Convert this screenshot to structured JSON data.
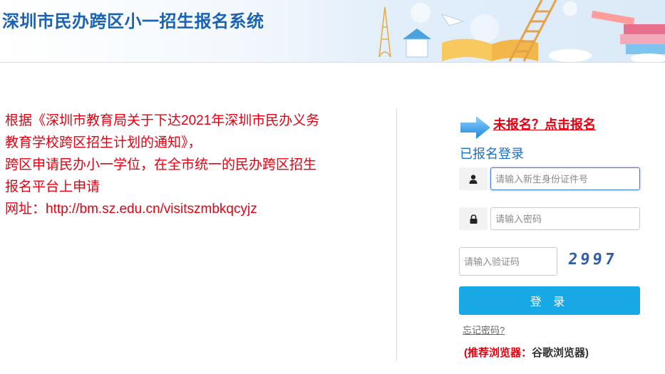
{
  "header": {
    "title": "深圳市民办跨区小一招生报名系统"
  },
  "notice": {
    "lines": [
      "根据《深圳市教育局关于下达2021年深圳市民办义务",
      "教育学校跨区招生计划的通知》，",
      "跨区申请民办小一学位，在全市统一的民办跨区招生",
      "报名平台上申请",
      "网址：http://bm.sz.edu.cn/visitszmbkqcyjz"
    ]
  },
  "login": {
    "register_link": "未报名？点击报名",
    "heading": "已报名登录",
    "id_placeholder": "请输入新生身份证件号",
    "password_placeholder": "请输入密码",
    "captcha_placeholder": "请输入验证码",
    "captcha_code": "2997",
    "submit_label": "登 录",
    "forgot_password": "忘记密码?",
    "browser_tip_label": "(推荐浏览器：",
    "browser_tip_value": "谷歌浏览器)"
  },
  "icons": {
    "register_arrow": "arrow-right-icon",
    "user": "user-icon",
    "lock": "lock-icon"
  },
  "colors": {
    "title_blue": "#1a63b4",
    "notice_red": "#e60012",
    "button_blue": "#19a8e6"
  }
}
